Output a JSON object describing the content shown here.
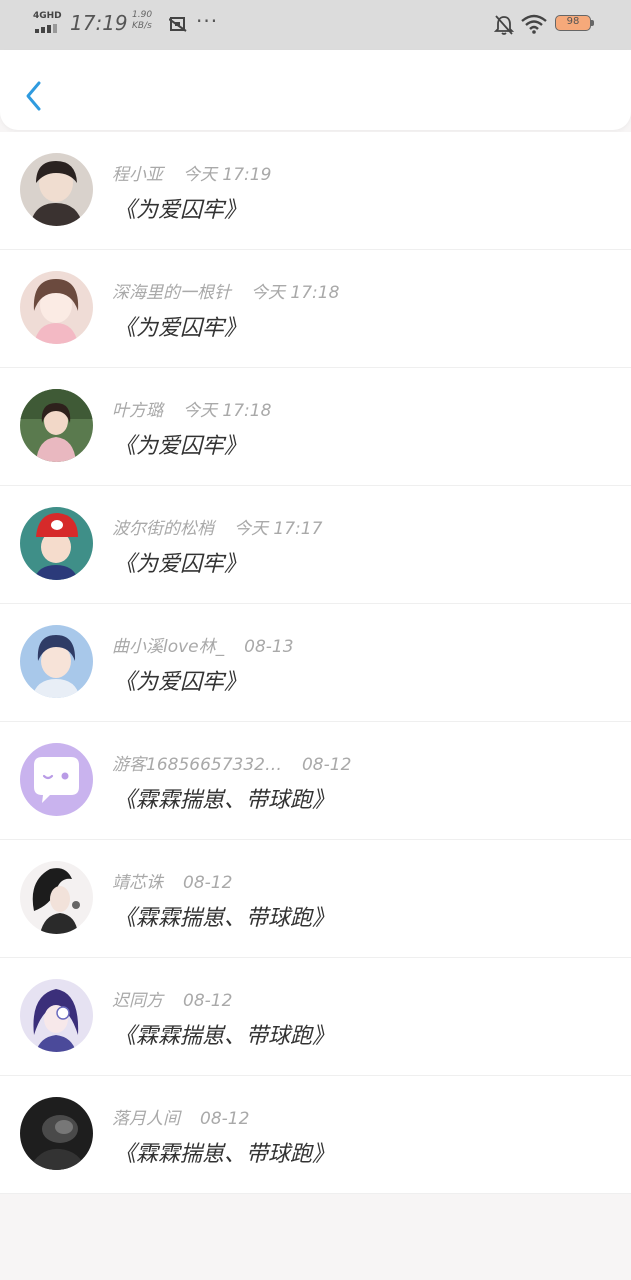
{
  "status_bar": {
    "network": "4GHD",
    "time": "17:19",
    "speed_value": "1.90",
    "speed_unit": "KB/s",
    "more": "···",
    "battery": "98",
    "battery_color": "#f6a97a"
  },
  "header": {
    "back_icon": "chevron-left-icon",
    "accent": "#2f9bdf"
  },
  "comments": [
    {
      "user": "程小亚",
      "time": "今天 17:19",
      "text": "《为爱囚牢》",
      "avatar_bg": "#cfc6c0"
    },
    {
      "user": "深海里的一根针",
      "time": "今天 17:18",
      "text": "《为爱囚牢》",
      "avatar_bg": "#efdcd6"
    },
    {
      "user": "叶方璐",
      "time": "今天 17:18",
      "text": "《为爱囚牢》",
      "avatar_bg": "#5a7a4e"
    },
    {
      "user": "波尔街的松梢",
      "time": "今天 17:17",
      "text": "《为爱囚牢》",
      "avatar_bg": "#3f8f88"
    },
    {
      "user": "曲小溪love林_",
      "time": "08-13",
      "text": "《为爱囚牢》",
      "avatar_bg": "#8fb6e0"
    },
    {
      "user": "游客16856657332…",
      "time": "08-12",
      "text": "《霖霖揣崽、带球跑》",
      "avatar_bg": "#c9b3ee"
    },
    {
      "user": "靖芯诛",
      "time": "08-12",
      "text": "《霖霖揣崽、带球跑》",
      "avatar_bg": "#f2efef"
    },
    {
      "user": "迟同方",
      "time": "08-12",
      "text": "《霖霖揣崽、带球跑》",
      "avatar_bg": "#d9d6ee"
    },
    {
      "user": "落月人间",
      "time": "08-12",
      "text": "《霖霖揣崽、带球跑》",
      "avatar_bg": "#2a2a2a"
    }
  ]
}
